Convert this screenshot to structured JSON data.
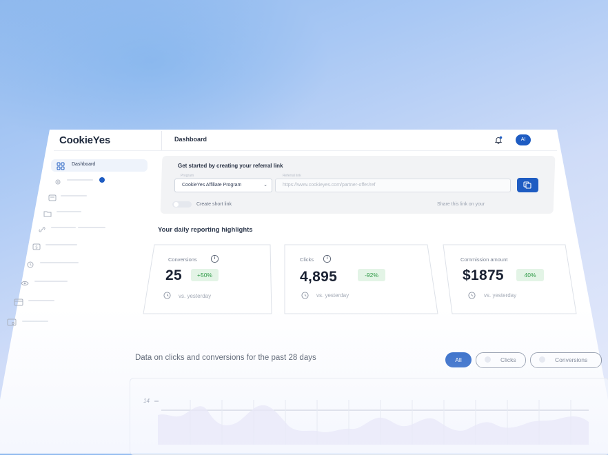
{
  "header": {
    "logo": "CookieYes",
    "page_title": "Dashboard",
    "avatar_initials": "AI"
  },
  "sidebar": {
    "active_item": {
      "label": "Dashboard",
      "icon": "grid-icon"
    },
    "other_icons": [
      "gear-icon",
      "card-icon",
      "folder-icon",
      "link-icon",
      "dollar-icon",
      "clock-icon",
      "eye-icon",
      "wallet-icon",
      "card-settings-icon"
    ]
  },
  "referral": {
    "title": "Get started by creating your referral link",
    "program_label": "Program",
    "program_value": "CookieYes Affiliate Program",
    "url_label": "Referral link",
    "url_value": "https://www.cookieyes.com/partner-offer/ref",
    "short_link_label": "Create short link",
    "share_label": "Share this link on your"
  },
  "highlights": {
    "title": "Your daily reporting highlights",
    "cards": [
      {
        "label": "Conversions",
        "value": "25",
        "change": "+50%",
        "vs": "vs. yesterday"
      },
      {
        "label": "Clicks",
        "value": "4,895",
        "change": "-92%",
        "vs": "vs. yesterday"
      },
      {
        "label": "Commission amount",
        "value": "$1875",
        "change": "40%",
        "vs": "vs. yesterday"
      }
    ]
  },
  "chart": {
    "title": "Data on clicks and conversions for the past 28 days",
    "filters": [
      "All",
      "Clicks",
      "Conversions"
    ],
    "active_filter": "All",
    "y_tick_top": "14"
  },
  "colors": {
    "accent": "#1e5cc2",
    "positive_bg": "#e3f4e6",
    "positive_text": "#2f9a47"
  }
}
